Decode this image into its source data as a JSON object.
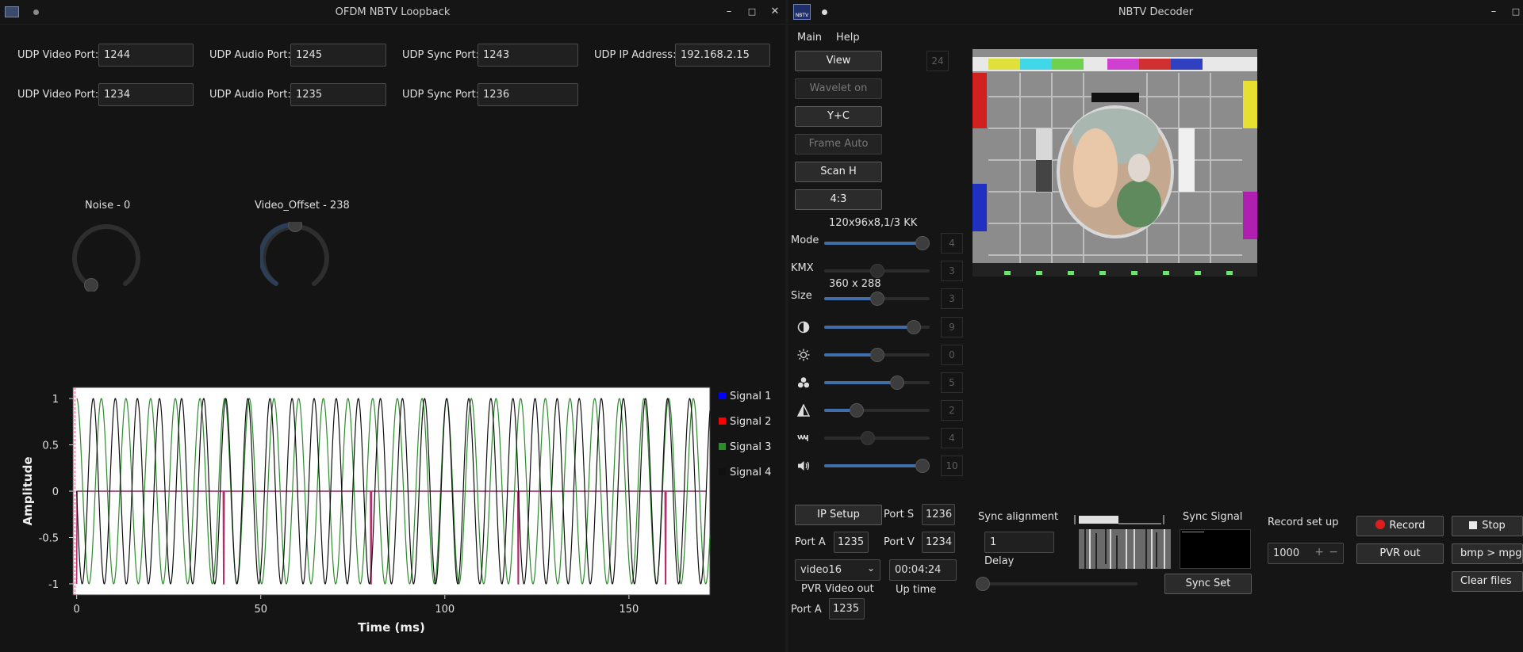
{
  "loopback": {
    "title": "OFDM NBTV Loopback",
    "rows": [
      [
        {
          "label": "UDP Video Port:",
          "value": "1244"
        },
        {
          "label": "UDP Audio Port:",
          "value": "1245"
        },
        {
          "label": "UDP Sync Port:",
          "value": "1243"
        },
        {
          "label": "UDP IP Address:",
          "value": "192.168.2.15"
        }
      ],
      [
        {
          "label": "UDP Video Port:",
          "value": "1234"
        },
        {
          "label": "UDP Audio Port:",
          "value": "1235"
        },
        {
          "label": "UDP Sync Port:",
          "value": "1236"
        }
      ]
    ],
    "dials": [
      {
        "label": "Noise - 0",
        "level": 0
      },
      {
        "label": "Video_Offset - 238",
        "level": 0.5
      }
    ]
  },
  "chart_data": {
    "type": "line",
    "xlabel": "Time (ms)",
    "ylabel": "Amplitude",
    "xlim": [
      -1,
      172
    ],
    "ylim": [
      -1.12,
      1.12
    ],
    "xticks": [
      "0",
      "50",
      "100",
      "150"
    ],
    "yticks": [
      "1",
      "0.5",
      "0",
      "-0.5",
      "-1"
    ],
    "grid": false,
    "legend_position": "right",
    "series": [
      {
        "name": "Signal 1",
        "color": "#0000ff",
        "kind": "flat",
        "value": 0
      },
      {
        "name": "Signal 2",
        "color": "#ff0000",
        "kind": "pulse",
        "value": 0,
        "pulse_every_ms": 40,
        "pulse_width_ms": 0.6,
        "pulse_low": -1
      },
      {
        "name": "Signal 3",
        "color": "#2d8a2d",
        "kind": "sine",
        "period_ms": 6.7,
        "amplitude": 1,
        "phase_deg": 0
      },
      {
        "name": "Signal 4",
        "color": "#101010",
        "kind": "sine",
        "period_ms": 6.0,
        "amplitude": 1,
        "phase_deg": 90
      }
    ]
  },
  "decoder": {
    "title": "NBTV Decoder",
    "menu": [
      "Main",
      "Help"
    ],
    "buttons": [
      {
        "label": "View",
        "enabled": true
      },
      {
        "label": "Wavelet on",
        "enabled": false
      },
      {
        "label": "Y+C",
        "enabled": true
      },
      {
        "label": "Frame Auto",
        "enabled": false
      },
      {
        "label": "Scan H",
        "enabled": true
      },
      {
        "label": "4:3",
        "enabled": true
      }
    ],
    "frame_counter": "24",
    "mode_caption": "120x96x8,1/3 KK",
    "size_caption": "360 x 288",
    "sliders": [
      {
        "label": "Mode",
        "icon": "",
        "value": "4",
        "level": 1.0,
        "enabled": true
      },
      {
        "label": "KMX",
        "icon": "",
        "value": "3",
        "level": 0.5,
        "enabled": false
      },
      {
        "label": "Size",
        "icon": "",
        "value": "3",
        "level": 0.5,
        "enabled": true
      },
      {
        "label": "",
        "icon": "contrast-icon",
        "value": "9",
        "level": 0.9,
        "enabled": true
      },
      {
        "label": "",
        "icon": "brightness-icon",
        "value": "0",
        "level": 0.5,
        "enabled": true
      },
      {
        "label": "",
        "icon": "color-icon",
        "value": "5",
        "level": 0.72,
        "enabled": true
      },
      {
        "label": "",
        "icon": "sharpness-icon",
        "value": "2",
        "level": 0.28,
        "enabled": true
      },
      {
        "label": "",
        "icon": "waveform-icon",
        "value": "4",
        "level": 0.4,
        "enabled": false
      },
      {
        "label": "",
        "icon": "volume-icon",
        "value": "10",
        "level": 1.0,
        "enabled": true
      }
    ],
    "ip_setup": "IP Setup",
    "port_s_label": "Port  S",
    "port_s": "1236",
    "port_a_label": "Port  A",
    "port_a": "1235",
    "port_v_label": "Port  V",
    "port_v": "1234",
    "device": "video16",
    "pvr_video_out": "PVR Video out",
    "uptime": "00:04:24",
    "uptime_label": "Up time",
    "port_a2_label": "Port  A",
    "port_a2": "1235",
    "sync_alignment_label": "Sync alignment",
    "sync_alignment": "1",
    "delay_label": "Delay",
    "delay_level": 0,
    "sync_signal_label": "Sync Signal",
    "sync_set": "Sync Set",
    "record_setup_label": "Record set up",
    "record_count": "1000",
    "record": "Record",
    "stop": "Stop",
    "pvr_out": "PVR out",
    "bmp_mpg": "bmp > mpg",
    "clear_files": "Clear files"
  }
}
